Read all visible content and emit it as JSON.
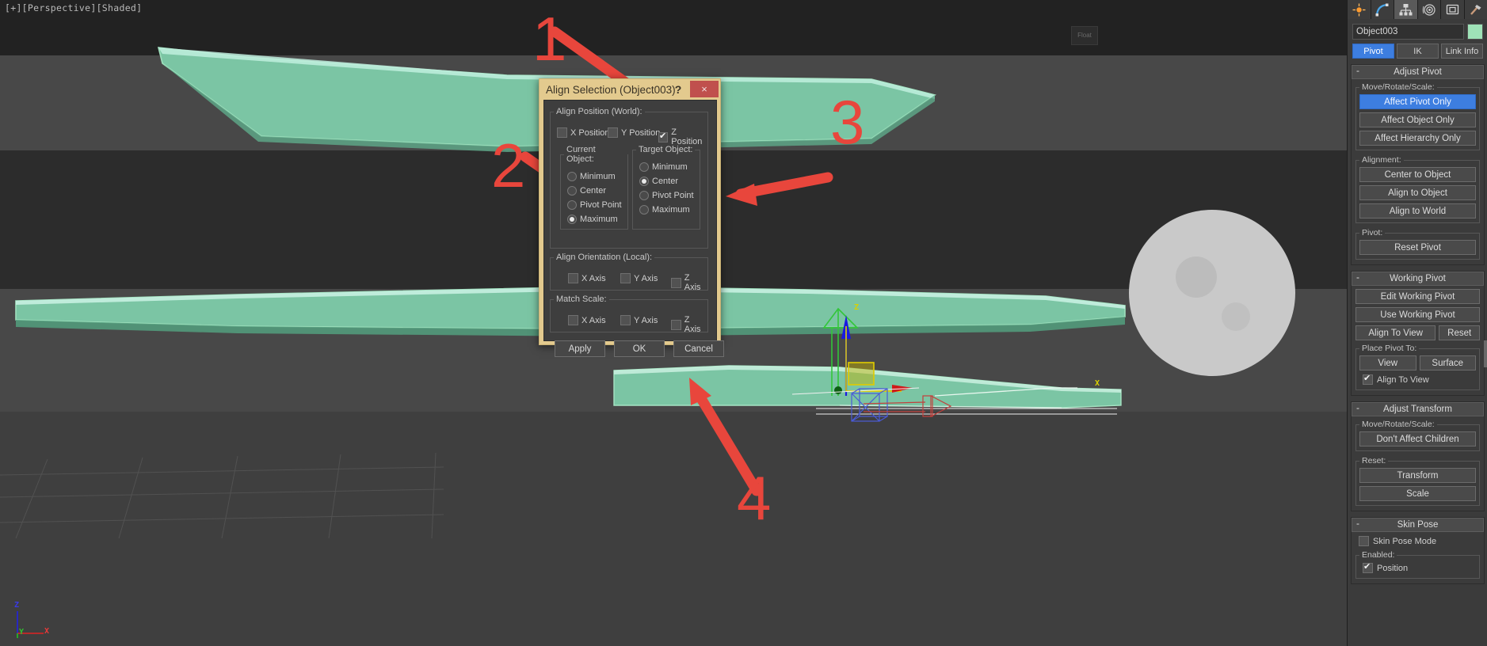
{
  "viewport": {
    "label": "[+][Perspective][Shaded]",
    "float_button": "Float",
    "tripod": {
      "z": "Z",
      "y": "Y",
      "x": "X"
    },
    "gizmo": {
      "z": "Z",
      "x": "X"
    }
  },
  "callouts": [
    {
      "number": "1"
    },
    {
      "number": "2"
    },
    {
      "number": "3"
    },
    {
      "number": "4"
    }
  ],
  "dialog": {
    "title": "Align Selection (Object003)",
    "help_label": "?",
    "close_label": "×",
    "align_position": {
      "legend": "Align Position (World):",
      "axes": [
        {
          "label": "X Position",
          "checked": false
        },
        {
          "label": "Y Position",
          "checked": false
        },
        {
          "label": "Z Position",
          "checked": true
        }
      ],
      "current_object": {
        "legend": "Current Object:",
        "options": [
          {
            "label": "Minimum",
            "selected": false
          },
          {
            "label": "Center",
            "selected": false
          },
          {
            "label": "Pivot Point",
            "selected": false
          },
          {
            "label": "Maximum",
            "selected": true
          }
        ]
      },
      "target_object": {
        "legend": "Target Object:",
        "options": [
          {
            "label": "Minimum",
            "selected": false
          },
          {
            "label": "Center",
            "selected": true
          },
          {
            "label": "Pivot Point",
            "selected": false
          },
          {
            "label": "Maximum",
            "selected": false
          }
        ]
      }
    },
    "align_orientation": {
      "legend": "Align Orientation (Local):",
      "axes": [
        {
          "label": "X Axis",
          "checked": false
        },
        {
          "label": "Y Axis",
          "checked": false
        },
        {
          "label": "Z Axis",
          "checked": false
        }
      ]
    },
    "match_scale": {
      "legend": "Match Scale:",
      "axes": [
        {
          "label": "X Axis",
          "checked": false
        },
        {
          "label": "Y Axis",
          "checked": false
        },
        {
          "label": "Z Axis",
          "checked": false
        }
      ]
    },
    "buttons": {
      "apply": "Apply",
      "ok": "OK",
      "cancel": "Cancel"
    }
  },
  "command_panel": {
    "icons": [
      {
        "name": "create-icon"
      },
      {
        "name": "modify-icon"
      },
      {
        "name": "hierarchy-icon",
        "active": true
      },
      {
        "name": "motion-icon"
      },
      {
        "name": "display-icon"
      },
      {
        "name": "utilities-icon"
      }
    ],
    "object_name": "Object003",
    "object_color": "#9fe3b8",
    "tabs": [
      {
        "label": "Pivot",
        "active": true
      },
      {
        "label": "IK",
        "active": false
      },
      {
        "label": "Link Info",
        "active": false
      }
    ],
    "rollouts": [
      {
        "title": "Adjust Pivot",
        "groups": [
          {
            "legend": "Move/Rotate/Scale:",
            "buttons": [
              {
                "label": "Affect Pivot Only",
                "highlighted": true
              },
              {
                "label": "Affect Object Only",
                "highlighted": false
              },
              {
                "label": "Affect Hierarchy Only",
                "highlighted": false
              }
            ]
          },
          {
            "legend": "Alignment:",
            "buttons": [
              {
                "label": "Center to Object",
                "highlighted": false
              },
              {
                "label": "Align to Object",
                "highlighted": false
              },
              {
                "label": "Align to World",
                "highlighted": false
              }
            ]
          },
          {
            "legend": "Pivot:",
            "buttons": [
              {
                "label": "Reset Pivot",
                "highlighted": false
              }
            ]
          }
        ]
      },
      {
        "title": "Working Pivot",
        "buttons": [
          {
            "label": "Edit Working Pivot"
          },
          {
            "label": "Use Working Pivot"
          }
        ],
        "row": [
          {
            "label": "Align To View"
          },
          {
            "label": "Reset"
          }
        ],
        "place_pivot": {
          "legend": "Place Pivot To:",
          "row": [
            {
              "label": "View"
            },
            {
              "label": "Surface"
            }
          ],
          "checkbox": {
            "label": "Align To View",
            "checked": true
          }
        }
      },
      {
        "title": "Adjust Transform",
        "groups": [
          {
            "legend": "Move/Rotate/Scale:",
            "buttons": [
              {
                "label": "Don't Affect Children",
                "highlighted": false
              }
            ]
          },
          {
            "legend": "Reset:",
            "buttons": [
              {
                "label": "Transform",
                "highlighted": false
              },
              {
                "label": "Scale",
                "highlighted": false
              }
            ]
          }
        ]
      },
      {
        "title": "Skin Pose",
        "checkbox": {
          "label": "Skin Pose Mode",
          "checked": false
        },
        "enabled_group": {
          "legend": "Enabled:",
          "checkbox": {
            "label": "Position",
            "checked": true
          }
        }
      }
    ]
  }
}
